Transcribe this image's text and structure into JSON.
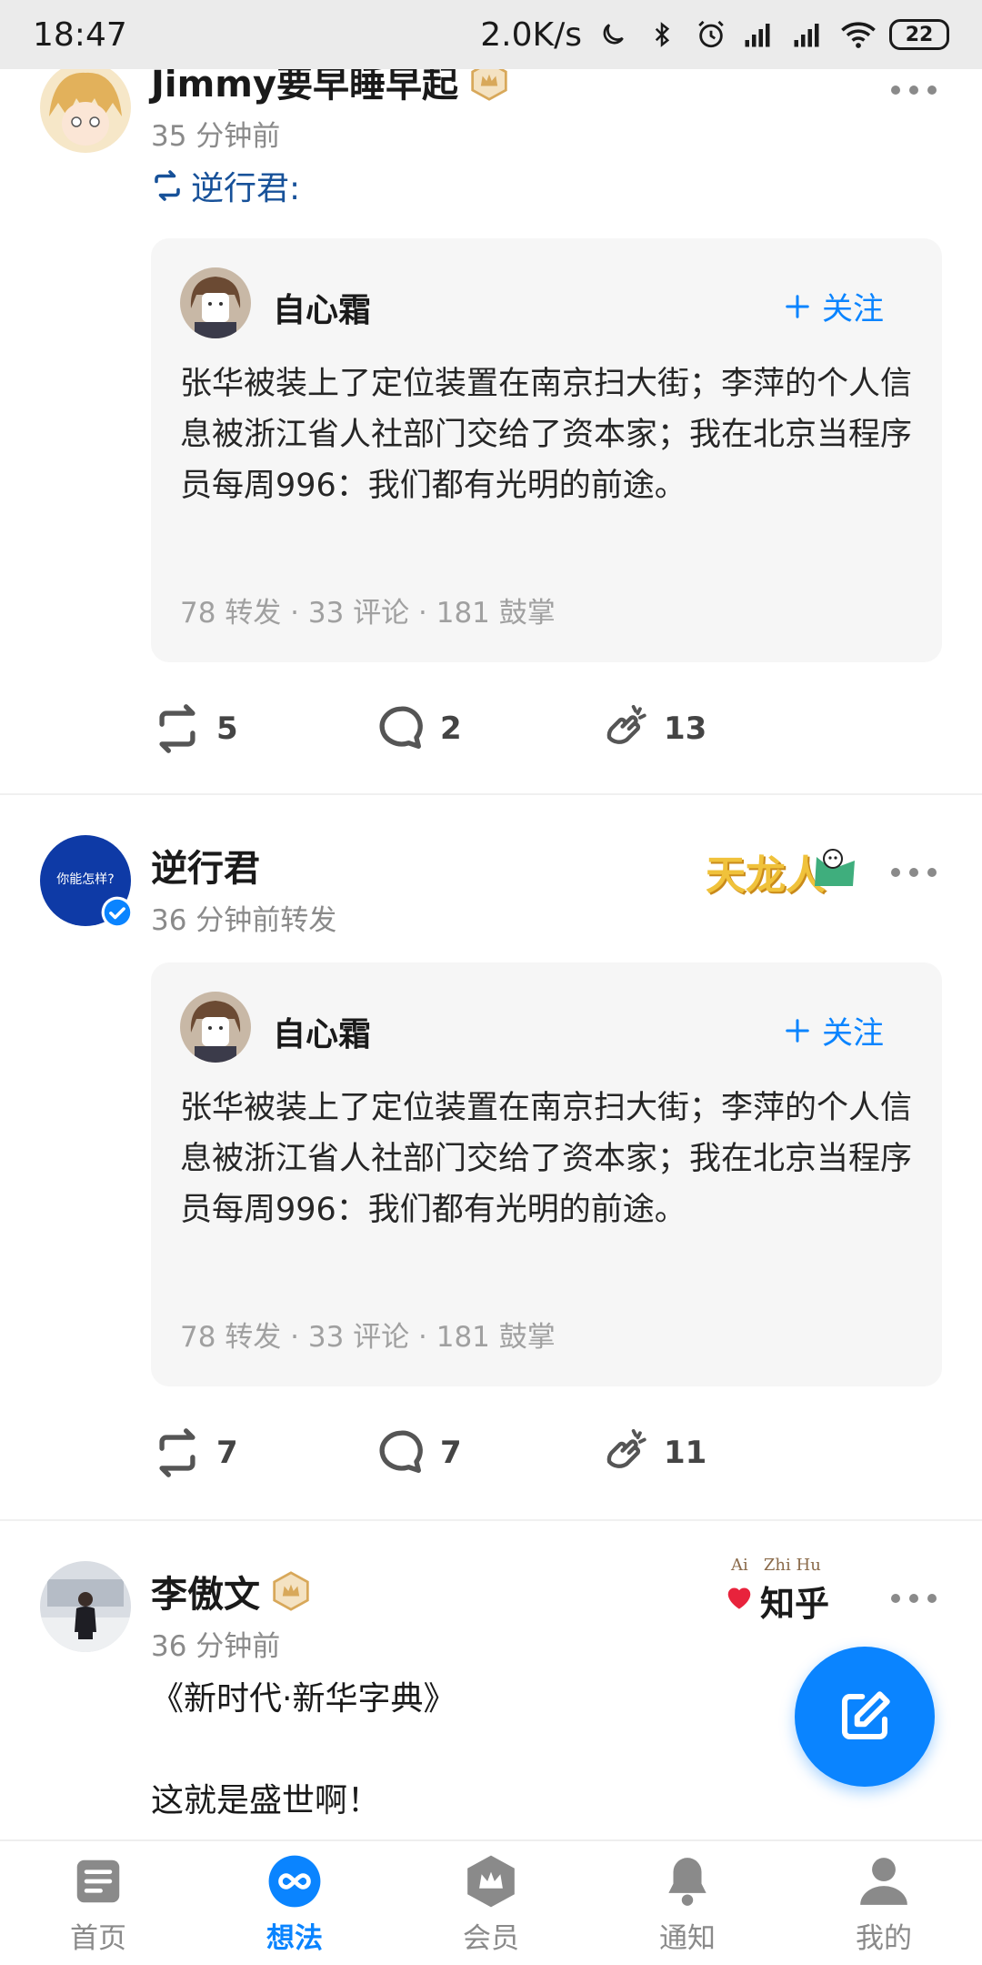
{
  "status_bar": {
    "time": "18:47",
    "net_speed": "2.0K/s",
    "battery": "22"
  },
  "posts": [
    {
      "author": "Jimmy要早睡早起",
      "time": "35 分钟前",
      "repost_from": "逆行君:",
      "card": {
        "author": "自心霜",
        "follow": "关注",
        "text": "张华被装上了定位装置在南京扫大街；李萍的个人信息被浙江省人社部门交给了资本家；我在北京当程序员每周996：我们都有光明的前途。",
        "stats": "78 转发 · 33 评论 · 181 鼓掌"
      },
      "actions": {
        "repost": "5",
        "comment": "2",
        "clap": "13"
      }
    },
    {
      "author": "逆行君",
      "avatar_text": "你能怎样?",
      "time": "36 分钟前转发",
      "sticker_text": "天龙人",
      "card": {
        "author": "自心霜",
        "follow": "关注",
        "text": "张华被装上了定位装置在南京扫大街；李萍的个人信息被浙江省人社部门交给了资本家；我在北京当程序员每周996：我们都有光明的前途。",
        "stats": "78 转发 · 33 评论 · 181 鼓掌"
      },
      "actions": {
        "repost": "7",
        "comment": "7",
        "clap": "11"
      }
    },
    {
      "author": "李傲文",
      "time": "36 分钟前",
      "sticker_small": "Ai   Zhi Hu",
      "sticker_text": "知乎",
      "lines": [
        "《新时代·新华字典》",
        "这就是盛世啊！"
      ]
    }
  ],
  "bottom_nav": [
    {
      "label": "首页",
      "icon": "home-icon"
    },
    {
      "label": "想法",
      "icon": "ideas-icon",
      "active": true
    },
    {
      "label": "会员",
      "icon": "vip-icon"
    },
    {
      "label": "通知",
      "icon": "bell-icon"
    },
    {
      "label": "我的",
      "icon": "profile-icon"
    }
  ],
  "colors": {
    "accent": "#0a84ff",
    "link": "#175199",
    "card_bg": "#f6f6f6",
    "crown": "#d8a85a"
  }
}
